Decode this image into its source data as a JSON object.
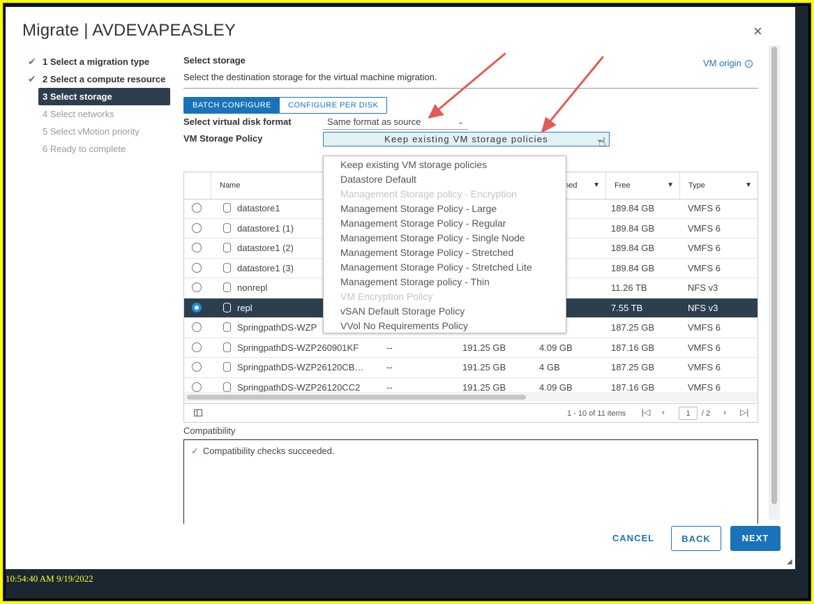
{
  "dialog": {
    "title": "Migrate | AVDEVAPEASLEY",
    "close_glyph": "×"
  },
  "steps": [
    {
      "label": "1 Select a migration type",
      "state": "done"
    },
    {
      "label": "2 Select a compute resource",
      "state": "done"
    },
    {
      "label": "3 Select storage",
      "state": "active"
    },
    {
      "label": "4 Select networks",
      "state": "pending"
    },
    {
      "label": "5 Select vMotion priority",
      "state": "pending"
    },
    {
      "label": "6 Ready to complete",
      "state": "pending"
    }
  ],
  "main": {
    "title": "Select storage",
    "description": "Select the destination storage for the virtual machine migration.",
    "vm_origin": "VM origin",
    "tabs": [
      "BATCH CONFIGURE",
      "CONFIGURE PER DISK"
    ],
    "disk_format_label": "Select virtual disk format",
    "disk_format_value": "Same format as source",
    "policy_label": "VM Storage Policy",
    "policy_value": "Keep existing VM storage policies"
  },
  "policy_options": [
    {
      "label": "Keep existing VM storage policies",
      "disabled": false
    },
    {
      "label": "Datastore Default",
      "disabled": false
    },
    {
      "label": "Management Storage policy - Encryption",
      "disabled": true
    },
    {
      "label": "Management Storage Policy - Large",
      "disabled": false
    },
    {
      "label": "Management Storage Policy - Regular",
      "disabled": false
    },
    {
      "label": "Management Storage Policy - Single Node",
      "disabled": false
    },
    {
      "label": "Management Storage Policy - Stretched",
      "disabled": false
    },
    {
      "label": "Management Storage Policy - Stretched Lite",
      "disabled": false
    },
    {
      "label": "Management Storage policy - Thin",
      "disabled": false
    },
    {
      "label": "VM Encryption Policy",
      "disabled": true
    },
    {
      "label": "vSAN Default Storage Policy",
      "disabled": false
    },
    {
      "label": "VVol No Requirements Policy",
      "disabled": false
    }
  ],
  "table": {
    "columns": [
      "Name",
      "oned",
      "Free",
      "Type"
    ],
    "rows": [
      {
        "name": "datastore1",
        "c2": "",
        "c3": "",
        "prov": "B",
        "free": "189.84 GB",
        "type": "VMFS 6",
        "selected": false
      },
      {
        "name": "datastore1 (1)",
        "c2": "",
        "c3": "",
        "prov": "B",
        "free": "189.84 GB",
        "type": "VMFS 6",
        "selected": false
      },
      {
        "name": "datastore1 (2)",
        "c2": "",
        "c3": "",
        "prov": "B",
        "free": "189.84 GB",
        "type": "VMFS 6",
        "selected": false
      },
      {
        "name": "datastore1 (3)",
        "c2": "",
        "c3": "",
        "prov": "B",
        "free": "189.84 GB",
        "type": "VMFS 6",
        "selected": false
      },
      {
        "name": "nonrepl",
        "c2": "",
        "c3": "",
        "prov": "TB",
        "free": "11.26 TB",
        "type": "NFS v3",
        "selected": false
      },
      {
        "name": "repl",
        "c2": "",
        "c3": "",
        "prov": "TB",
        "free": "7.55 TB",
        "type": "NFS v3",
        "selected": true
      },
      {
        "name": "SpringpathDS-WZP",
        "c2": "",
        "c3": "",
        "prov": "",
        "free": "187.25 GB",
        "type": "VMFS 6",
        "selected": false
      },
      {
        "name": "SpringpathDS-WZP260901KF",
        "c2": "--",
        "c3": "191.25 GB",
        "prov": "4.09 GB",
        "free": "187.16 GB",
        "type": "VMFS 6",
        "selected": false
      },
      {
        "name": "SpringpathDS-WZP26120CB…",
        "c2": "--",
        "c3": "191.25 GB",
        "prov": "4 GB",
        "free": "187.25 GB",
        "type": "VMFS 6",
        "selected": false
      },
      {
        "name": "SpringpathDS-WZP26120CC2",
        "c2": "--",
        "c3": "191.25 GB",
        "prov": "4.09 GB",
        "free": "187.16 GB",
        "type": "VMFS 6",
        "selected": false
      }
    ],
    "pagination": {
      "count": "1 - 10 of 11 items",
      "page": "1",
      "total": "/ 2"
    }
  },
  "compatibility": {
    "label": "Compatibility",
    "message": "Compatibility checks succeeded."
  },
  "buttons": {
    "cancel": "CANCEL",
    "back": "BACK",
    "next": "NEXT"
  },
  "timestamp": "10:54:40 AM 9/19/2022",
  "colors": {
    "accent": "#1a73b8",
    "selected_row": "#2d3e4f",
    "frame": "#ffff00",
    "annotation_arrow": "#e25b55"
  }
}
